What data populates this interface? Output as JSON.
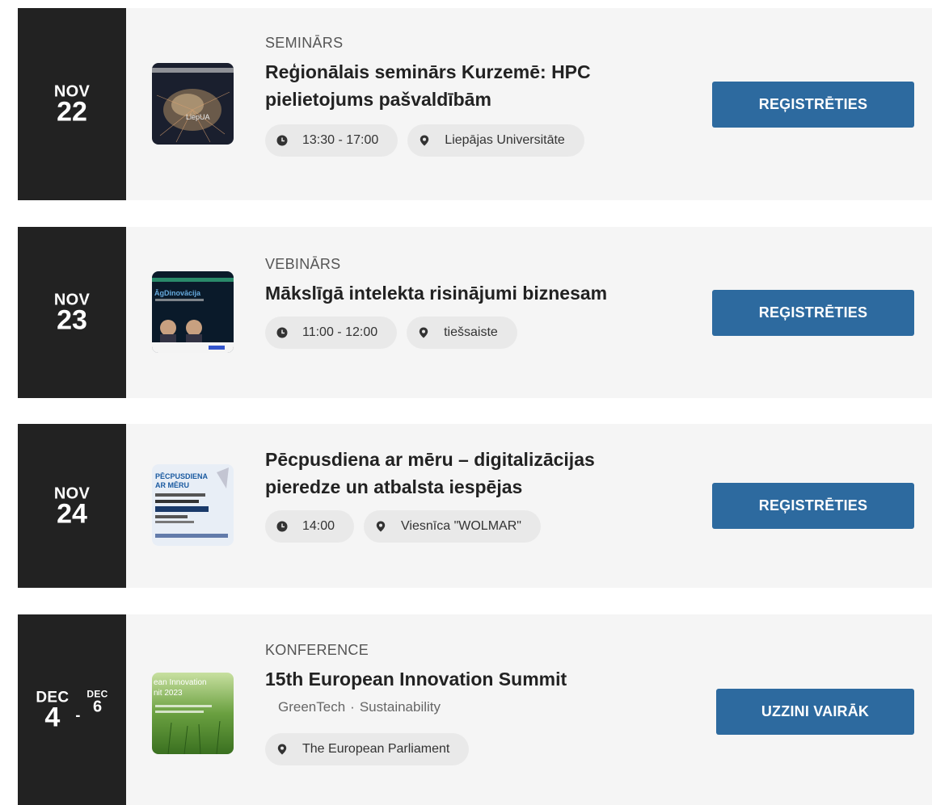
{
  "events": [
    {
      "date_month": "NOV",
      "date_day": "22",
      "category": "SEMINĀRS",
      "title_line1": "Reģionālais seminārs Kurzemē: HPC",
      "title_line2": "pielietojums pašvaldībām",
      "time": "13:30 - 17:00",
      "location": "Liepājas Universitāte",
      "button_label": "REĢISTRĒTIES"
    },
    {
      "date_month": "NOV",
      "date_day": "23",
      "category": "VEBINĀRS",
      "title_line1": "Mākslīgā intelekta risinājumi biznesam",
      "title_line2": "",
      "time": "11:00 - 12:00",
      "location": "tiešsaiste",
      "button_label": "REĢISTRĒTIES"
    },
    {
      "date_month": "NOV",
      "date_day": "24",
      "category": "",
      "title_line1": "Pēcpusdiena ar mēru – digitalizācijas",
      "title_line2": "pieredze un atbalsta iespējas",
      "time": "14:00",
      "location": "Viesnīca \"WOLMAR\"",
      "button_label": "REĢISTRĒTIES"
    },
    {
      "date_month": "DEC",
      "date_day": "4",
      "date_end_month": "DEC",
      "date_end_day": "6",
      "date_separator": "-",
      "category": "KONFERENCE",
      "title_line1": "15th European Innovation Summit",
      "title_line2": "",
      "tags": [
        "GreenTech",
        "Sustainability"
      ],
      "tag_separator": "·",
      "location": "The European Parliament",
      "button_label": "UZZINI VAIRĀK"
    }
  ],
  "thumbnails": {
    "e0": "LiepUA",
    "e1": "ĀgDinovācija",
    "e2_line1": "PĒCPUSDIENA",
    "e2_line2": "AR MĒRU",
    "e3_line1": "ean Innovation",
    "e3_line2": "nit 2023"
  },
  "colors": {
    "date_bg": "#222222",
    "card_bg": "#f5f5f5",
    "pill_bg": "#e9e9e9",
    "button_bg": "#2d6a9f"
  },
  "icons": {
    "time": "clock-icon",
    "location": "map-pin-icon"
  }
}
